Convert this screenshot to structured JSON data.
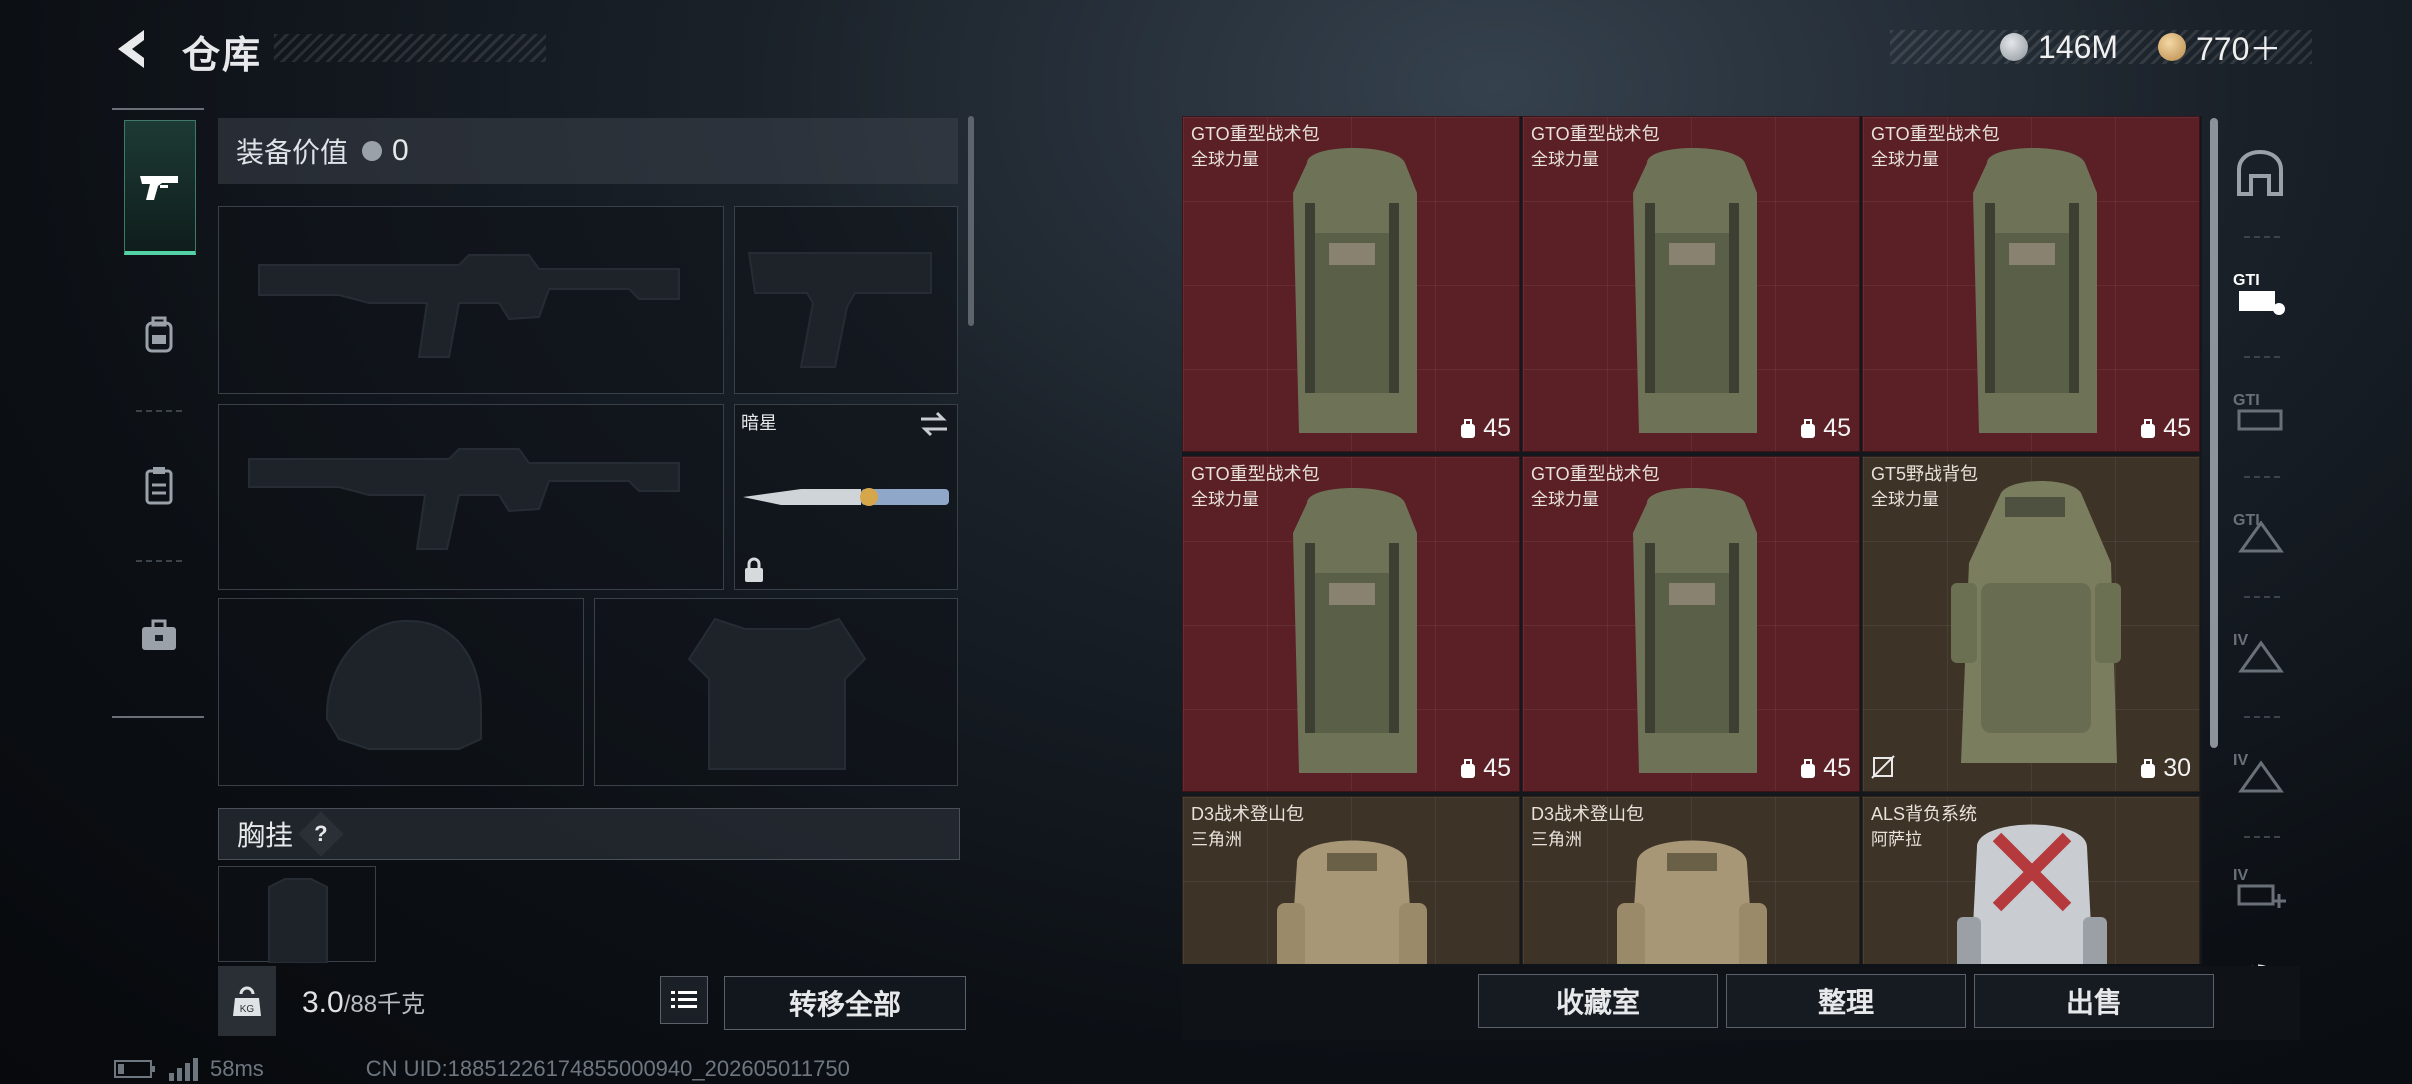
{
  "header": {
    "title": "仓库",
    "currency_silver": "146M",
    "currency_gold": "770＋"
  },
  "left_nav": {
    "items": [
      "pistol-icon",
      "backpack-icon",
      "clipboard-icon",
      "briefcase-icon"
    ]
  },
  "equipment": {
    "value_label": "装备价值",
    "value_amount": "0",
    "knife_name": "暗星",
    "chest_rig_label": "胸挂",
    "help_label": "?",
    "kg_label": "KG",
    "weight_value": "3.0",
    "weight_max": "/88千克",
    "transfer_all_label": "转移全部"
  },
  "storage": {
    "items": [
      {
        "name": "GTO重型战术包",
        "sub": "全球力量",
        "capacity": "45",
        "bg": "red"
      },
      {
        "name": "GTO重型战术包",
        "sub": "全球力量",
        "capacity": "45",
        "bg": "red"
      },
      {
        "name": "GTO重型战术包",
        "sub": "全球力量",
        "capacity": "45",
        "bg": "red"
      },
      {
        "name": "GTO重型战术包",
        "sub": "全球力量",
        "capacity": "45",
        "bg": "red"
      },
      {
        "name": "GTO重型战术包",
        "sub": "全球力量",
        "capacity": "45",
        "bg": "red"
      },
      {
        "name": "GT5野战背包",
        "sub": "全球力量",
        "capacity": "30",
        "bg": "tan"
      },
      {
        "name": "D3战术登山包",
        "sub": "三角洲",
        "capacity": "",
        "bg": "tan"
      },
      {
        "name": "D3战术登山包",
        "sub": "三角洲",
        "capacity": "",
        "bg": "tan"
      },
      {
        "name": "ALS背负系统",
        "sub": "阿萨拉",
        "capacity": "",
        "bg": "tan"
      }
    ],
    "buttons": {
      "collection": "收藏室",
      "sort": "整理",
      "sell": "出售"
    }
  },
  "right_nav": {
    "labels": [
      "",
      "GTI",
      "GTI",
      "GTI",
      "IV",
      "IV",
      "IV"
    ]
  },
  "status": {
    "ping": "58ms",
    "uid": "CN UID:18851226174855000940_202605011750"
  },
  "colors": {
    "accent": "#53d3a5",
    "red_cell": "#5a2026",
    "tan_cell": "#3e3327"
  }
}
